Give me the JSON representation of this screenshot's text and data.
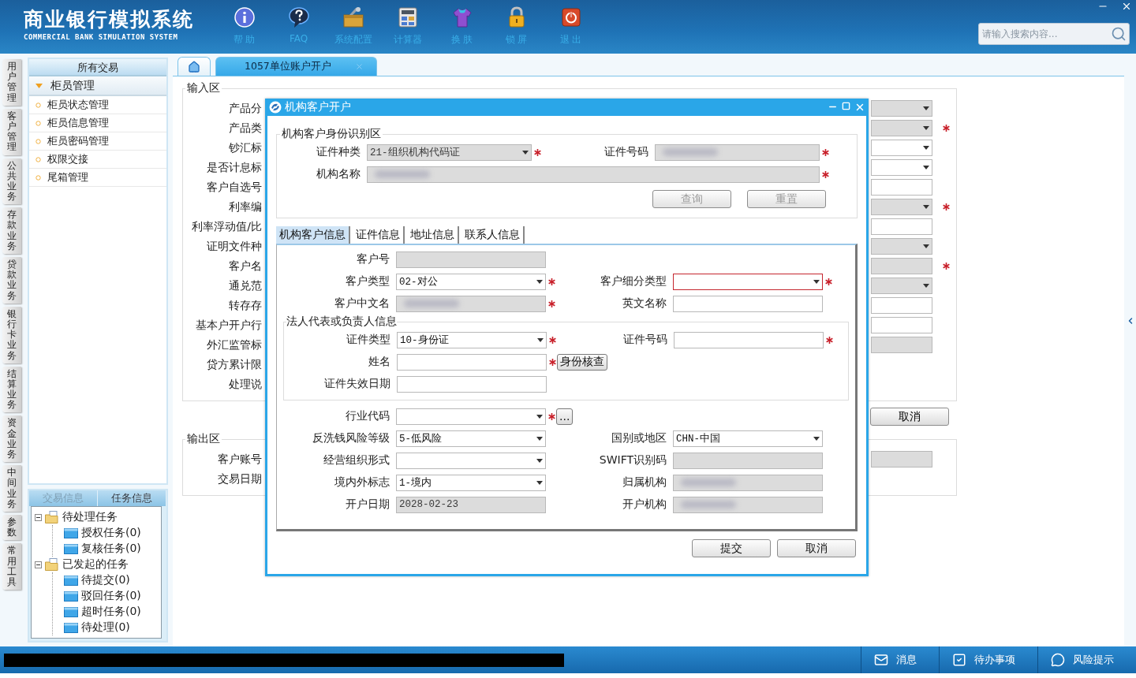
{
  "header": {
    "title": "商业银行模拟系统",
    "subtitle": "COMMERCIAL BANK SIMULATION SYSTEM",
    "toolbar": [
      {
        "kind": "info",
        "label": "帮 助"
      },
      {
        "kind": "help",
        "label": "FAQ"
      },
      {
        "kind": "config",
        "label": "系统配置"
      },
      {
        "kind": "calculator",
        "label": "计算器"
      },
      {
        "kind": "skin",
        "label": "换 肤"
      },
      {
        "kind": "lock",
        "label": "锁 屏"
      },
      {
        "kind": "exit",
        "label": "退 出"
      }
    ],
    "search": {
      "placeholder": "请输入搜索内容..."
    }
  },
  "nav_rail": [
    "用户管理",
    "客户管理",
    "公共业务",
    "存款业务",
    "贷款业务",
    "银行卡业务",
    "结算业务",
    "资金业务",
    "中间业务",
    "参数",
    "常用工具"
  ],
  "menu": {
    "title": "所有交易",
    "group": {
      "label": "柜员管理",
      "expanded": true,
      "items": [
        "柜员状态管理",
        "柜员信息管理",
        "柜员密码管理",
        "权限交接",
        "尾箱管理"
      ]
    }
  },
  "task_panel": {
    "tabs": [
      {
        "label": "交易信息",
        "selected": false
      },
      {
        "label": "任务信息",
        "selected": true
      }
    ],
    "tree": [
      {
        "label": "待处理任务",
        "expanded": true,
        "children": [
          {
            "label": "授权任务(0)"
          },
          {
            "label": "复核任务(0)"
          }
        ]
      },
      {
        "label": "已发起的任务",
        "expanded": true,
        "children": [
          {
            "label": "待提交(0)"
          },
          {
            "label": "驳回任务(0)"
          },
          {
            "label": "超时任务(0)"
          },
          {
            "label": "待处理(0)"
          }
        ]
      }
    ]
  },
  "tabs": [
    {
      "kind": "home",
      "selected": false
    },
    {
      "kind": "page",
      "label": "1057单位账户开户",
      "selected": true
    }
  ],
  "input_area": {
    "title": "输入区",
    "rows": [
      {
        "label": "产品分",
        "field": {
          "kind": "select",
          "disabled": true,
          "required": false
        }
      },
      {
        "label": "产品类",
        "field": {
          "kind": "select",
          "disabled": true,
          "required": true
        }
      },
      {
        "label": "钞汇标",
        "field": {
          "kind": "select",
          "disabled": false,
          "required": false
        }
      },
      {
        "label": "是否计息标",
        "field": {
          "kind": "select",
          "disabled": false,
          "required": false
        }
      },
      {
        "label": "客户自选号",
        "field": {
          "kind": "text",
          "disabled": false,
          "required": false
        }
      },
      {
        "label": "利率编",
        "field": {
          "kind": "select",
          "disabled": true,
          "required": true
        }
      },
      {
        "label": "利率浮动值/比",
        "field": {
          "kind": "text",
          "disabled": false,
          "required": false
        }
      },
      {
        "label": "证明文件种",
        "field": {
          "kind": "select",
          "disabled": true,
          "required": false
        }
      },
      {
        "label": "客户名",
        "field": {
          "kind": "text",
          "disabled": true,
          "required": true
        }
      },
      {
        "label": "通兑范",
        "field": {
          "kind": "select",
          "disabled": true,
          "required": false
        }
      },
      {
        "label": "转存存",
        "field": {
          "kind": "text",
          "disabled": false,
          "required": false
        }
      },
      {
        "label": "基本户开户行",
        "field": {
          "kind": "text",
          "disabled": false,
          "required": false
        }
      },
      {
        "label": "外汇监管标",
        "field": {
          "kind": "text",
          "disabled": true,
          "required": false
        }
      },
      {
        "label": "贷方累计限"
      },
      {
        "label": "处理说"
      }
    ],
    "buttons": [
      "取消"
    ]
  },
  "output_area": {
    "title": "输出区",
    "rows": [
      {
        "label": "客户账号",
        "field": {
          "kind": "text",
          "disabled": true,
          "required": false
        }
      },
      {
        "label": "交易日期"
      }
    ]
  },
  "dialog": {
    "title": "机构客户开户",
    "identity": {
      "title": "机构客户身份识别区",
      "rows": [
        {
          "cells": [
            {
              "label": "证件种类",
              "kind": "select",
              "value": "21-组织机构代码证",
              "disabled": true,
              "required": true,
              "invalid": false,
              "redacted": false
            },
            {
              "label": "证件号码",
              "kind": "text",
              "disabled": true,
              "required": true,
              "invalid": false,
              "redacted": true
            }
          ]
        },
        {
          "cells": [
            {
              "label": "机构名称",
              "kind": "text",
              "disabled": true,
              "required": true,
              "invalid": false,
              "redacted": true
            }
          ]
        }
      ],
      "buttons": [
        {
          "label": "查询",
          "disabled": true
        },
        {
          "label": "重置",
          "disabled": true
        }
      ]
    },
    "tabs": [
      {
        "label": "机构客户信息",
        "selected": true
      },
      {
        "label": "证件信息",
        "selected": false
      },
      {
        "label": "地址信息",
        "selected": false
      },
      {
        "label": "联系人信息",
        "selected": false
      }
    ],
    "sections": [
      {
        "kind": "fields",
        "rows": [
          {
            "cells": [
              {
                "label": "客户号",
                "kind": "text",
                "disabled": true,
                "required": false,
                "invalid": false,
                "redacted": false
              }
            ]
          },
          {
            "cells": [
              {
                "label": "客户类型",
                "kind": "select",
                "value": "02-对公",
                "disabled": false,
                "required": true,
                "invalid": false,
                "redacted": false
              },
              {
                "label": "客户细分类型",
                "kind": "select",
                "disabled": false,
                "required": true,
                "invalid": true,
                "redacted": false
              }
            ]
          },
          {
            "cells": [
              {
                "label": "客户中文名",
                "kind": "text",
                "disabled": true,
                "required": true,
                "invalid": false,
                "redacted": true
              },
              {
                "label": "英文名称",
                "kind": "text",
                "disabled": false,
                "required": false,
                "invalid": false,
                "redacted": false
              }
            ]
          }
        ]
      },
      {
        "kind": "group",
        "title": "法人代表或负责人信息",
        "rows": [
          {
            "cells": [
              {
                "label": "证件类型",
                "kind": "select",
                "value": "10-身份证",
                "disabled": false,
                "required": true,
                "invalid": false,
                "redacted": false
              },
              {
                "label": "证件号码",
                "kind": "text",
                "disabled": false,
                "required": true,
                "invalid": false,
                "redacted": false
              }
            ]
          },
          {
            "cells": [
              {
                "label": "姓名",
                "kind": "text",
                "disabled": false,
                "required": true,
                "invalid": false,
                "redacted": false,
                "button": "身份核查"
              }
            ]
          },
          {
            "cells": [
              {
                "label": "证件失效日期",
                "kind": "text",
                "disabled": false,
                "required": false,
                "invalid": false,
                "redacted": false
              }
            ]
          }
        ]
      },
      {
        "kind": "fields",
        "rows": [
          {
            "cells": [
              {
                "label": "行业代码",
                "kind": "select",
                "disabled": false,
                "required": true,
                "invalid": false,
                "redacted": false,
                "button": "..."
              }
            ]
          },
          {
            "cells": [
              {
                "label": "反洗钱风险等级",
                "kind": "select",
                "value": "5-低风险",
                "disabled": false,
                "required": false,
                "invalid": false,
                "redacted": false
              },
              {
                "label": "国别或地区",
                "kind": "select",
                "value": "CHN-中国",
                "disabled": false,
                "required": false,
                "invalid": false,
                "redacted": false
              }
            ]
          },
          {
            "cells": [
              {
                "label": "经营组织形式",
                "kind": "select",
                "disabled": false,
                "required": false,
                "invalid": false,
                "redacted": false
              },
              {
                "label": "SWIFT识别码",
                "kind": "text",
                "disabled": true,
                "required": false,
                "invalid": false,
                "redacted": false
              }
            ]
          },
          {
            "cells": [
              {
                "label": "境内外标志",
                "kind": "select",
                "value": "1-境内",
                "disabled": false,
                "required": false,
                "invalid": false,
                "redacted": false
              },
              {
                "label": "归属机构",
                "kind": "text",
                "disabled": true,
                "required": false,
                "invalid": false,
                "redacted": true
              }
            ]
          },
          {
            "cells": [
              {
                "label": "开户日期",
                "kind": "text",
                "value": "2028-02-23",
                "disabled": true,
                "required": false,
                "invalid": false,
                "redacted": false
              },
              {
                "label": "开户机构",
                "kind": "text",
                "disabled": true,
                "required": false,
                "invalid": false,
                "redacted": true
              }
            ]
          }
        ]
      }
    ],
    "buttons": [
      "提交",
      "取消"
    ]
  },
  "status_bar": {
    "items": [
      {
        "kind": "message",
        "label": "消息"
      },
      {
        "kind": "todo",
        "label": "待办事项"
      },
      {
        "kind": "risk",
        "label": "风险提示"
      }
    ]
  }
}
